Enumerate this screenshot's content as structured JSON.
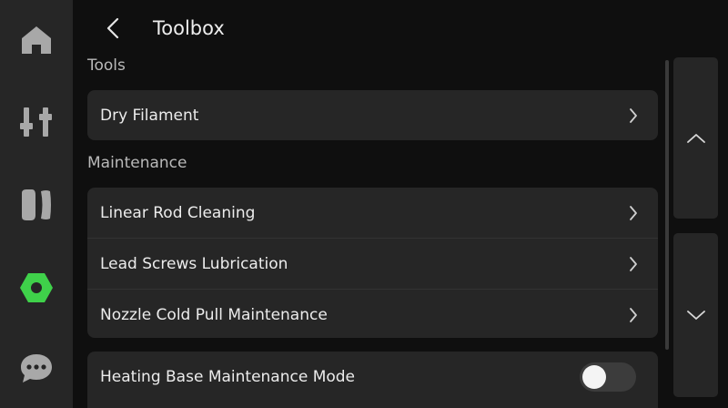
{
  "header": {
    "title": "Toolbox"
  },
  "sections": {
    "tools": {
      "label": "Tools",
      "items": [
        {
          "label": "Dry Filament"
        }
      ]
    },
    "maintenance": {
      "label": "Maintenance",
      "items": [
        {
          "label": "Linear Rod Cleaning"
        },
        {
          "label": "Lead Screws Lubrication"
        },
        {
          "label": "Nozzle Cold Pull Maintenance"
        }
      ]
    },
    "settings": {
      "items": [
        {
          "label": "Heating Base Maintenance Mode",
          "toggle_on": false
        }
      ]
    }
  },
  "sidebar": {
    "items": [
      {
        "icon": "home-icon"
      },
      {
        "icon": "sliders-icon"
      },
      {
        "icon": "filament-icon"
      },
      {
        "icon": "hex-nut-icon",
        "active": true
      },
      {
        "icon": "chat-icon"
      }
    ]
  },
  "colors": {
    "accent": "#3fd14a",
    "icon": "#a8a8a8",
    "panel": "#262626",
    "background": "#0f0f0f"
  }
}
